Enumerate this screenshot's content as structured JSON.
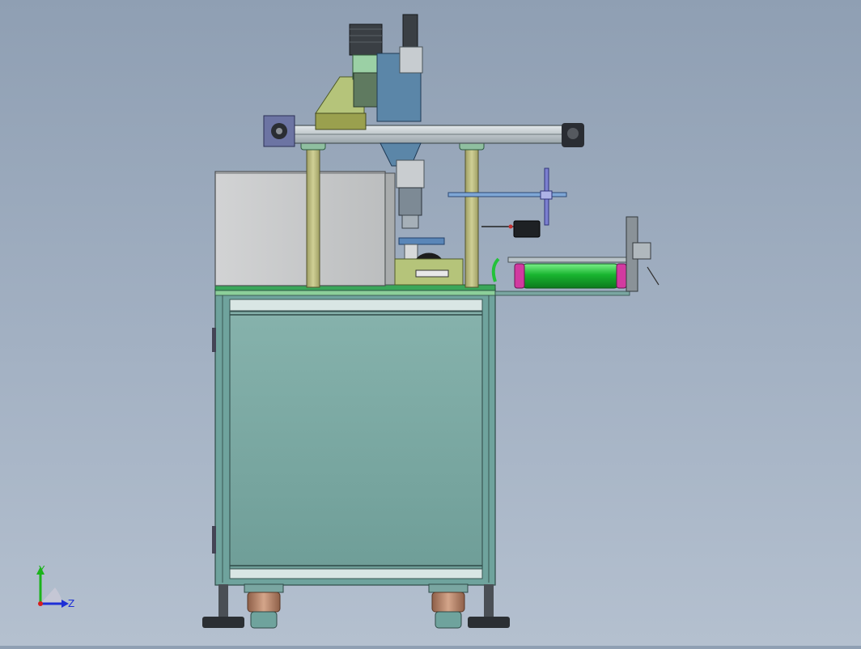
{
  "viewport": {
    "background_top": "#8f9fb3",
    "background_bottom": "#b4c0cf"
  },
  "triad": {
    "y_label": "Y",
    "z_label": "Z",
    "y_color": "#1bb31b",
    "z_color": "#1e2fd6",
    "x_color": "#d61e1e"
  },
  "model_colors": {
    "frame": "#6fa39d",
    "frame_panel": "#7aa6a1",
    "column": "#b7b77a",
    "rail": "#b9c3c8",
    "enclosure": "#c9cbcc",
    "stage": "#5b86a8",
    "roller": "#23c23a",
    "roller_caps": "#d23aa0",
    "feet": "#b08066",
    "motor": "#3a3f44",
    "base_plate": "#3aa65a"
  }
}
